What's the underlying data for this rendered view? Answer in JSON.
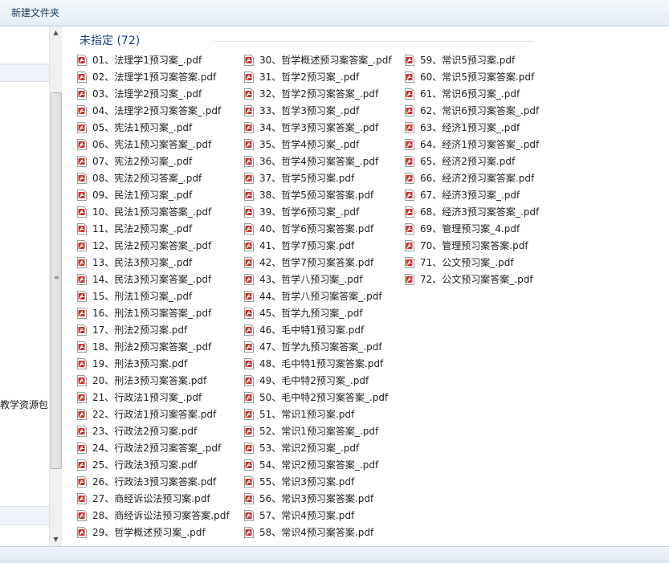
{
  "toolbar": {
    "new_folder_label": "新建文件夹"
  },
  "nav": {
    "visible_label": "教学资源包"
  },
  "group": {
    "label": "未指定 (72)"
  },
  "files": [
    "01、法理学1预习案_.pdf",
    "02、法理学1预习案答案.pdf",
    "03、法理学2预习案_.pdf",
    "04、法理学2预习案答案_.pdf",
    "05、宪法1预习案_.pdf",
    "06、宪法1预习案答案_.pdf",
    "07、宪法2预习案_.pdf",
    "08、宪法2预习答案_.pdf",
    "09、民法1预习案_.pdf",
    "10、民法1预习案答案_.pdf",
    "11、民法2预习案_.pdf",
    "12、民法2预习案答案_.pdf",
    "13、民法3预习案_.pdf",
    "14、民法3预习案答案_.pdf",
    "15、刑法1预习案_.pdf",
    "16、刑法1预习案答案_.pdf",
    "17、刑法2预习案.pdf",
    "18、刑法2预习案答案_.pdf",
    "19、刑法3预习案.pdf",
    "20、刑法3预习案答案.pdf",
    "21、行政法1预习案_.pdf",
    "22、行政法1预习案答案.pdf",
    "23、行政法2预习案.pdf",
    "24、行政法2预习案答案_.pdf",
    "25、行政法3预习案.pdf",
    "26、行政法3预习案答案.pdf",
    "27、商经诉讼法预习案.pdf",
    "28、商经诉讼法预习案答案.pdf",
    "29、哲学概述预习案_.pdf",
    "30、哲学概述预习案答案_.pdf",
    "31、哲学2预习案_.pdf",
    "32、哲学2预习案答案_.pdf",
    "33、哲学3预习案_.pdf",
    "34、哲学3预习案答案_.pdf",
    "35、哲学4预习案_.pdf",
    "36、哲学4预习案答案_.pdf",
    "37、哲学5预习案.pdf",
    "38、哲学5预习案答案.pdf",
    "39、哲学6预习案_.pdf",
    "40、哲学6预习案答案.pdf",
    "41、哲学7预习案.pdf",
    "42、哲学7预习案答案.pdf",
    "43、哲学八预习案_.pdf",
    "44、哲学八预习案答案_.pdf",
    "45、哲学九预习案_.pdf",
    "46、毛中特1预习案.pdf",
    "47、哲学九预习案答案_.pdf",
    "48、毛中特1预习案答案.pdf",
    "49、毛中特2预习案_.pdf",
    "50、毛中特2预习案答案_.pdf",
    "51、常识1预习案.pdf",
    "52、常识1预习案答案_.pdf",
    "53、常识2预习案_.pdf",
    "54、常识2预习案答案_.pdf",
    "55、常识3预习案.pdf",
    "56、常识3预习案答案.pdf",
    "57、常识4预习案.pdf",
    "58、常识4预习案答案.pdf",
    "59、常识5预习案.pdf",
    "60、常识5预习案答案.pdf",
    "61、常识6预习案_.pdf",
    "62、常识6预习案答案_.pdf",
    "63、经济1预习案_.pdf",
    "64、经济1预习案答案_.pdf",
    "65、经济2预习案.pdf",
    "66、经济2预习案答案.pdf",
    "67、经济3预习案_.pdf",
    "68、经济3预习案答案_.pdf",
    "69、管理预习案_4.pdf",
    "70、管理预习案答案.pdf",
    "71、公文预习案_.pdf",
    "72、公文预习案答案_.pdf"
  ],
  "icon": {
    "file_type": "pdf-icon",
    "color": "#c8322b"
  }
}
